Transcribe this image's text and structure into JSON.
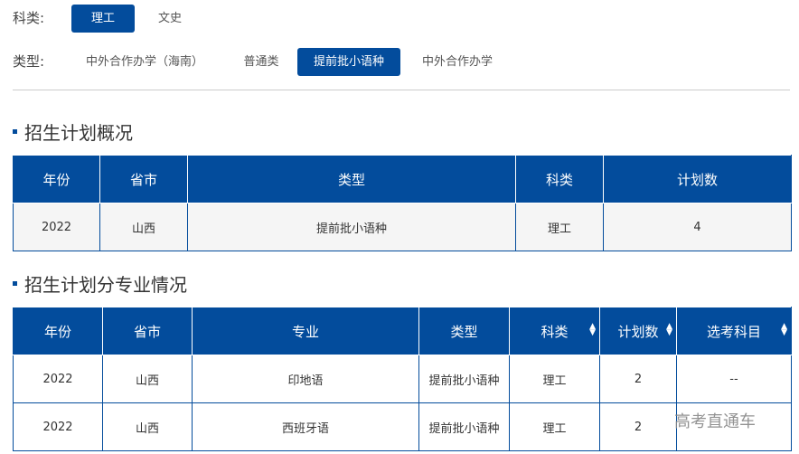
{
  "filters": {
    "subject_label": "科类:",
    "subjects": [
      "理工",
      "文史"
    ],
    "type_label": "类型:",
    "types": [
      "中外合作办学（海南）",
      "普通类",
      "提前批小语种",
      "中外合作办学"
    ]
  },
  "colors": {
    "accent": "#034c9c"
  },
  "overview": {
    "title": "招生计划概况",
    "headers": [
      "年份",
      "省市",
      "类型",
      "科类",
      "计划数"
    ],
    "rows": [
      [
        "2022",
        "山西",
        "提前批小语种",
        "理工",
        "4"
      ]
    ]
  },
  "majors": {
    "title": "招生计划分专业情况",
    "headers": [
      "年份",
      "省市",
      "专业",
      "类型",
      "科类",
      "计划数",
      "选考科目"
    ],
    "rows": [
      [
        "2022",
        "山西",
        "印地语",
        "提前批小语种",
        "理工",
        "2",
        "--"
      ],
      [
        "2022",
        "山西",
        "西班牙语",
        "提前批小语种",
        "理工",
        "2",
        ""
      ]
    ]
  },
  "watermark": "高考直通车"
}
